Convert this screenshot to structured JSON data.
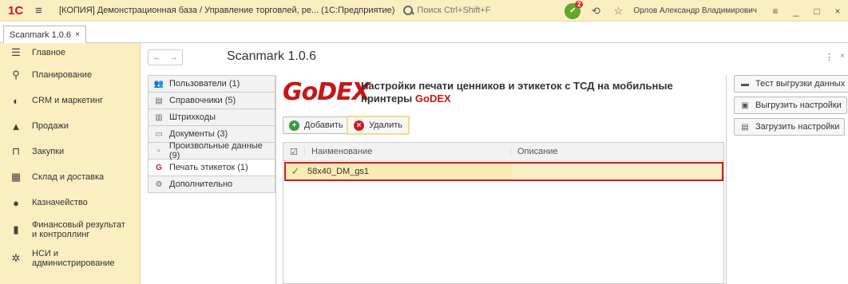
{
  "titlebar": {
    "logo": "1С",
    "menu_icon": "≡",
    "title": "[КОПИЯ] Демонстрационная база / Управление торговлей, ре... (1С:Предприятие)",
    "search_placeholder": "Поиск Ctrl+Shift+F",
    "notification_badge": "2",
    "user": "Орлов Александр Владимирович"
  },
  "tabs": [
    {
      "label": "Scanmark 1.0.6",
      "close": "×"
    }
  ],
  "sidebar": {
    "items": [
      {
        "label": "Главное",
        "icon": "menu-icon"
      },
      {
        "label": "Планирование",
        "icon": "planning-icon"
      },
      {
        "label": "CRM и маркетинг",
        "icon": "crm-icon"
      },
      {
        "label": "Продажи",
        "icon": "sales-icon"
      },
      {
        "label": "Закупки",
        "icon": "cart-icon"
      },
      {
        "label": "Склад и доставка",
        "icon": "warehouse-icon"
      },
      {
        "label": "Казначейство",
        "icon": "treasury-icon"
      },
      {
        "label": "Финансовый результат и контроллинг",
        "icon": "chart-icon"
      },
      {
        "label": "НСИ и администрирование",
        "icon": "gear-icon"
      }
    ]
  },
  "form": {
    "title": "Scanmark 1.0.6",
    "back": "←",
    "forward": "→",
    "menu": "⋮",
    "close": "×"
  },
  "subnav": {
    "items": [
      {
        "label": "Пользователи (1)",
        "icon": "users-icon"
      },
      {
        "label": "Справочники (5)",
        "icon": "catalog-icon"
      },
      {
        "label": "Штрихкоды",
        "icon": "barcode-icon"
      },
      {
        "label": "Документы (3)",
        "icon": "document-icon"
      },
      {
        "label": "Произвольные данные (9)",
        "icon": "data-icon"
      },
      {
        "label": "Печать этикеток (1)",
        "icon": "godex-icon",
        "active": true
      },
      {
        "label": "Дополнительно",
        "icon": "gear-icon"
      }
    ]
  },
  "content": {
    "logo": "GoDEX",
    "heading": "Настройки печати ценников и этикеток с ТСД на мобильные принтеры",
    "brand": "GoDEX",
    "add_button": "Добавить",
    "delete_button": "Удалить",
    "table": {
      "columns": [
        "Наименование",
        "Описание"
      ],
      "rows": [
        {
          "name": "58x40_DM_gs1",
          "description": ""
        }
      ]
    }
  },
  "actions": {
    "test_export": "Тест выгрузки данных",
    "export_settings": "Выгрузить настройки",
    "import_settings": "Загрузить настройки"
  },
  "colors": {
    "brand_red": "#c41818",
    "sidebar_bg": "#fbeec1",
    "selection": "#fbeab3",
    "highlight_border": "#d0191f"
  }
}
